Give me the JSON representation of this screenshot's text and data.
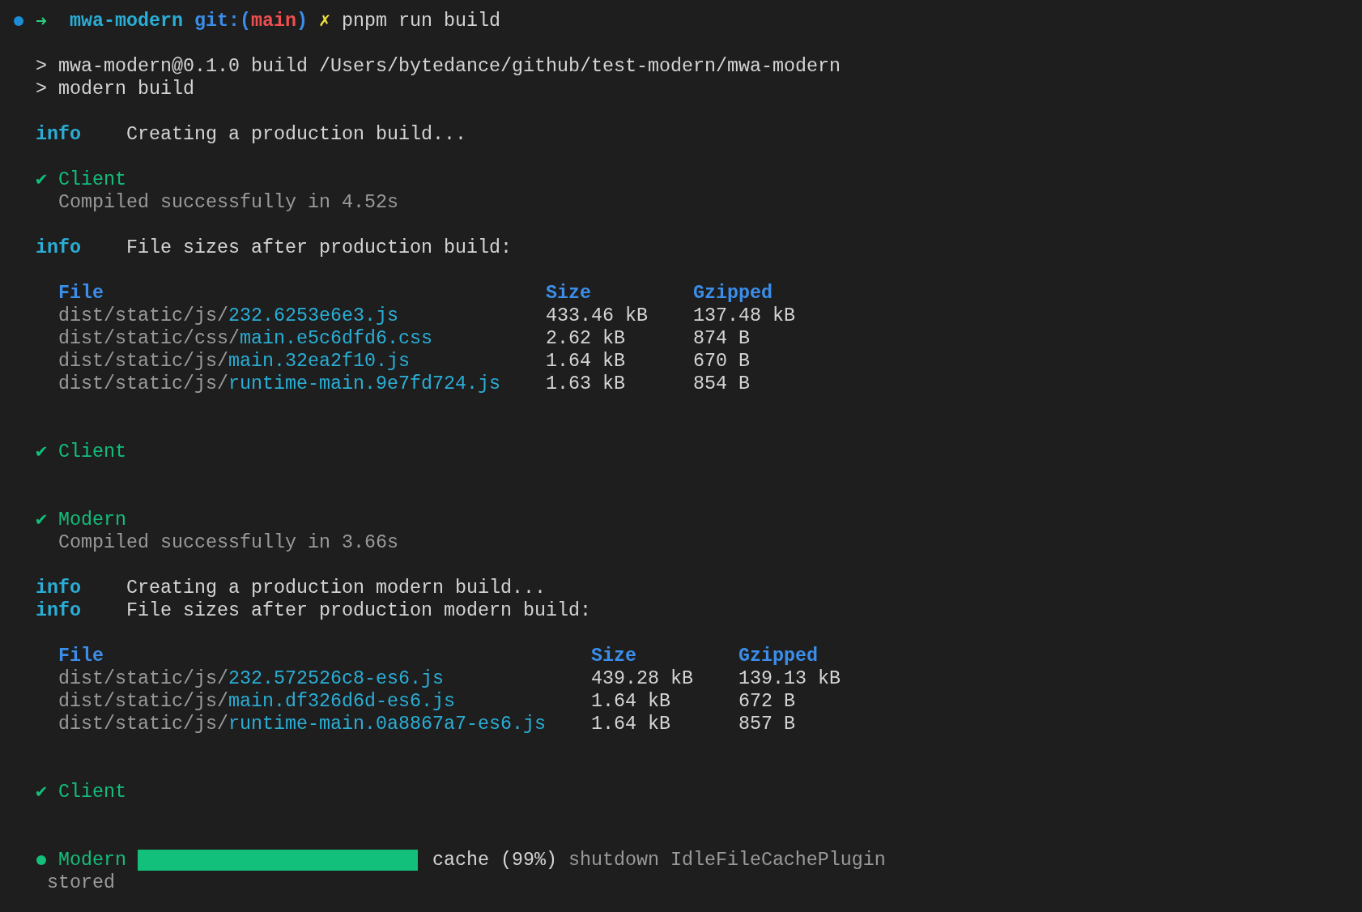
{
  "prompt": {
    "directory": "mwa-modern",
    "git_label": "git:(",
    "branch": "main",
    "git_close": ")",
    "dirty_mark": "✗",
    "command": "pnpm run build"
  },
  "script_lines": [
    "> mwa-modern@0.1.0 build /Users/bytedance/github/test-modern/mwa-modern",
    "> modern build"
  ],
  "blocks": [
    {
      "kind": "info",
      "lines": [
        {
          "label": "info",
          "message": "Creating a production build..."
        }
      ]
    },
    {
      "kind": "success",
      "mark": "✔",
      "name": "Client",
      "detail": "Compiled successfully in 4.52s"
    },
    {
      "kind": "info",
      "lines": [
        {
          "label": "info",
          "message": "File sizes after production build:"
        }
      ]
    },
    {
      "kind": "table",
      "columns": [
        "File",
        "Size",
        "Gzipped"
      ],
      "rows": [
        {
          "dir": "dist/static/js/",
          "file": "232.6253e6e3.js",
          "size": "433.46 kB",
          "gzipped": "137.48 kB"
        },
        {
          "dir": "dist/static/css/",
          "file": "main.e5c6dfd6.css",
          "size": "2.62 kB",
          "gzipped": "874 B"
        },
        {
          "dir": "dist/static/js/",
          "file": "main.32ea2f10.js",
          "size": "1.64 kB",
          "gzipped": "670 B"
        },
        {
          "dir": "dist/static/js/",
          "file": "runtime-main.9e7fd724.js",
          "size": "1.63 kB",
          "gzipped": "854 B"
        }
      ]
    },
    {
      "kind": "success",
      "mark": "✔",
      "name": "Client"
    },
    {
      "kind": "success",
      "mark": "✔",
      "name": "Modern",
      "detail": "Compiled successfully in 3.66s"
    },
    {
      "kind": "info",
      "lines": [
        {
          "label": "info",
          "message": "Creating a production modern build..."
        },
        {
          "label": "info",
          "message": "File sizes after production modern build:"
        }
      ]
    },
    {
      "kind": "table",
      "columns": [
        "File",
        "Size",
        "Gzipped"
      ],
      "rows": [
        {
          "dir": "dist/static/js/",
          "file": "232.572526c8-es6.js",
          "size": "439.28 kB",
          "gzipped": "139.13 kB"
        },
        {
          "dir": "dist/static/js/",
          "file": "main.df326d6d-es6.js",
          "size": "1.64 kB",
          "gzipped": "672 B"
        },
        {
          "dir": "dist/static/js/",
          "file": "runtime-main.0a8867a7-es6.js",
          "size": "1.64 kB",
          "gzipped": "857 B"
        }
      ]
    },
    {
      "kind": "success",
      "mark": "✔",
      "name": "Client"
    },
    {
      "kind": "progress",
      "name": "Modern",
      "level": 0.99,
      "status": "cache (99%)",
      "message": "shutdown IdleFileCachePlugin",
      "continuation": "stored"
    }
  ]
}
